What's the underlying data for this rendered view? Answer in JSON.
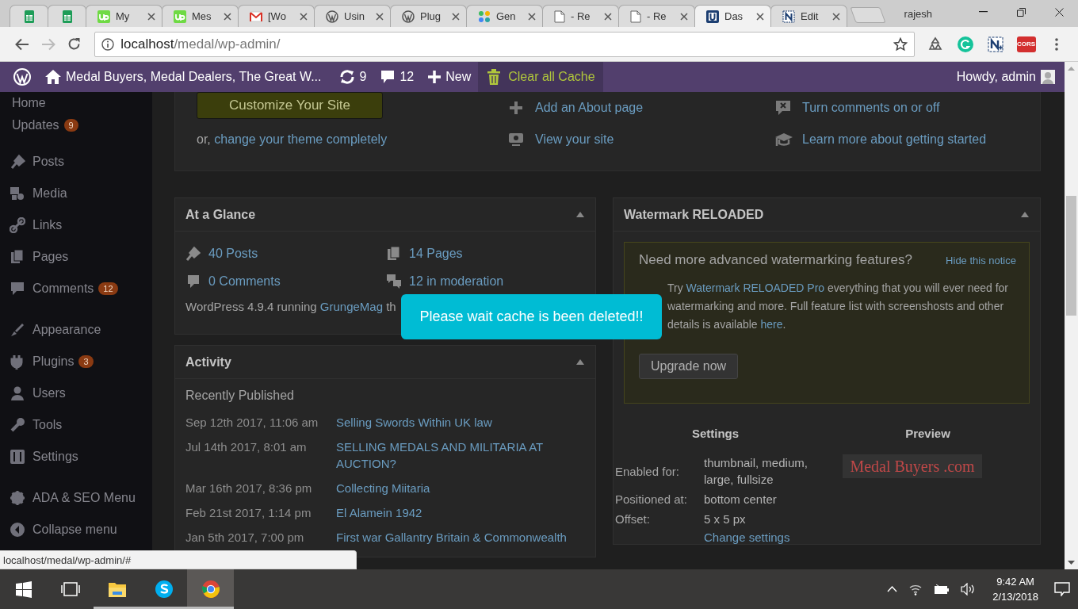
{
  "browser": {
    "tabs": [
      {
        "kind": "sheets",
        "pinned": true,
        "selected": false
      },
      {
        "kind": "sheets",
        "pinned": true,
        "selected": false
      },
      {
        "kind": "up",
        "title": "My",
        "pinned": false,
        "selected": false
      },
      {
        "kind": "up",
        "title": "Mes",
        "pinned": false,
        "selected": false
      },
      {
        "kind": "mail",
        "title": "[Wo",
        "pinned": false,
        "selected": false
      },
      {
        "kind": "wp",
        "title": "Usin",
        "pinned": false,
        "selected": false
      },
      {
        "kind": "wp",
        "title": "Plug",
        "pinned": false,
        "selected": false
      },
      {
        "kind": "dots",
        "title": "Gen",
        "pinned": false,
        "selected": false
      },
      {
        "kind": "page",
        "title": "- Re",
        "pinned": false,
        "selected": false
      },
      {
        "kind": "page",
        "title": "- Re",
        "pinned": false,
        "selected": false
      },
      {
        "kind": "u",
        "title": "Das",
        "pinned": false,
        "selected": true
      },
      {
        "kind": "n",
        "title": "Edit",
        "pinned": false,
        "selected": false
      }
    ],
    "profile": "rajesh",
    "back_disabled": false,
    "forward_disabled": true,
    "address": {
      "host": "localhost",
      "path": "/medal/wp-admin/"
    },
    "extension_badge": "CORS"
  },
  "admin_bar": {
    "site_name": "Medal Buyers, Medal Dealers, The Great W...",
    "updates": "9",
    "comments": "12",
    "new": "New",
    "cache": "Clear all Cache",
    "howdy": "Howdy, admin"
  },
  "sidebar": {
    "groups": [
      {
        "items": [
          {
            "kind": "plain",
            "label": "Home"
          },
          {
            "kind": "plain",
            "label": "Updates",
            "badge": "9"
          }
        ]
      },
      {
        "items": [
          {
            "kind": "posts",
            "label": "Posts"
          },
          {
            "kind": "media",
            "label": "Media"
          },
          {
            "kind": "links",
            "label": "Links"
          },
          {
            "kind": "pages",
            "label": "Pages"
          },
          {
            "kind": "comments",
            "label": "Comments",
            "badge": "12"
          }
        ]
      },
      {
        "items": [
          {
            "kind": "appearance",
            "label": "Appearance"
          },
          {
            "kind": "plugins",
            "label": "Plugins",
            "badge": "3"
          },
          {
            "kind": "users",
            "label": "Users"
          },
          {
            "kind": "tools",
            "label": "Tools"
          },
          {
            "kind": "settings",
            "label": "Settings"
          }
        ]
      },
      {
        "items": [
          {
            "kind": "gear",
            "label": "ADA & SEO Menu"
          },
          {
            "kind": "collapse",
            "label": "Collapse menu"
          }
        ]
      }
    ]
  },
  "welcome": {
    "customize_button": "Customize Your Site",
    "alt_prefix": "or, ",
    "alt_link": "change your theme completely",
    "columns": [
      {
        "actions": [
          {
            "kind": "plus",
            "label": "Add an About page"
          },
          {
            "kind": "screen",
            "label": "View your site"
          }
        ]
      },
      {
        "actions": [
          {
            "kind": "comment-off",
            "label": "Turn comments on or off"
          },
          {
            "kind": "cap",
            "label": "Learn more about getting started"
          }
        ]
      }
    ]
  },
  "at_a_glance": {
    "title": "At a Glance",
    "items": [
      {
        "kind": "pin",
        "label": "40 Posts"
      },
      {
        "kind": "pages",
        "label": "14 Pages"
      },
      {
        "kind": "comment",
        "label": "0 Comments"
      },
      {
        "kind": "comments",
        "label": "12 in moderation"
      }
    ],
    "version_prefix": "WordPress 4.9.4 running ",
    "theme_link": "GrungeMag",
    "version_suffix": " th"
  },
  "activity": {
    "title": "Activity",
    "subtitle": "Recently Published",
    "posts": [
      {
        "date": "Sep 12th 2017, 11:06 am",
        "title": "Selling Swords Within UK law"
      },
      {
        "date": "Jul 14th 2017, 8:01 am",
        "title": "SELLING MEDALS AND MILITARIA AT AUCTION?"
      },
      {
        "date": "Mar 16th 2017, 8:36 pm",
        "title": "Collecting Miitaria"
      },
      {
        "date": "Feb 21st 2017, 1:14 pm",
        "title": "El Alamein 1942"
      },
      {
        "date": "Jan 5th 2017, 7:00 pm",
        "title": "First war Gallantry Britain & Commonwealth"
      }
    ]
  },
  "watermark": {
    "title": "Watermark RELOADED",
    "notice": {
      "heading": "Need more advanced watermarking features?",
      "hide": "Hide this notice",
      "prefix": "Try ",
      "pro_link": "Watermark RELOADED Pro",
      "middle": " everything that you will ever need for watermarking and more. Full feature list with screenshosts and other details is available ",
      "here_link": "here",
      "suffix": ".",
      "button": "Upgrade now"
    },
    "settings_heading": "Settings",
    "preview_heading": "Preview",
    "settings": [
      {
        "label": "Enabled for:",
        "value": "thumbnail, medium, large, fullsize"
      },
      {
        "label": "Positioned at:",
        "value": "bottom center"
      },
      {
        "label": "Offset:",
        "value": "5 x 5 px"
      }
    ],
    "change_link": "Change settings",
    "preview_text": "Medal Buyers .com"
  },
  "toast": "Please wait cache is been deleted!!",
  "status_url": "localhost/medal/wp-admin/#",
  "taskbar": {
    "apps": [
      {
        "kind": "start",
        "running": false,
        "selected": false
      },
      {
        "kind": "task-view",
        "running": false,
        "selected": false
      },
      {
        "kind": "explorer",
        "running": true,
        "selected": false
      },
      {
        "kind": "skype",
        "running": true,
        "selected": false
      },
      {
        "kind": "chrome",
        "running": true,
        "selected": true
      }
    ],
    "time": "9:42 AM",
    "date": "2/13/2018"
  }
}
